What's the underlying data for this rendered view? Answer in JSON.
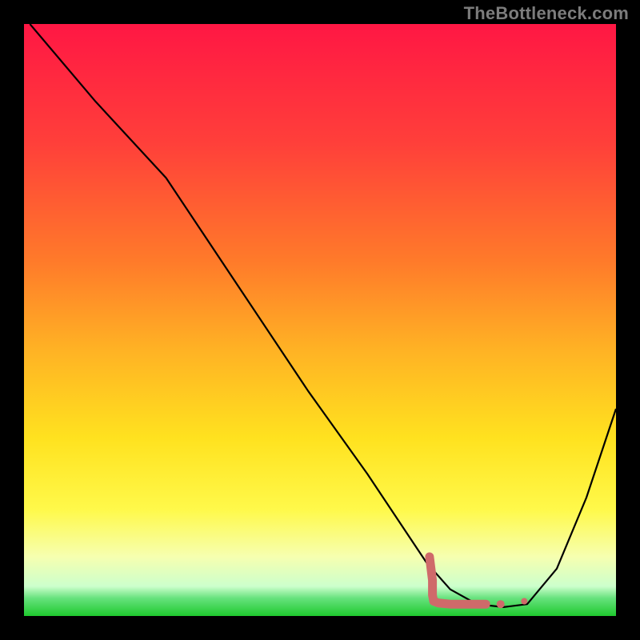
{
  "watermark": "TheBottleneck.com",
  "chart_data": {
    "type": "line",
    "title": "",
    "xlabel": "",
    "ylabel": "",
    "xlim": [
      0,
      100
    ],
    "ylim": [
      0,
      100
    ],
    "background_gradient": {
      "stops": [
        {
          "offset": 0.0,
          "color": "#ff1744"
        },
        {
          "offset": 0.2,
          "color": "#ff3f3a"
        },
        {
          "offset": 0.4,
          "color": "#ff7a2a"
        },
        {
          "offset": 0.55,
          "color": "#ffb224"
        },
        {
          "offset": 0.7,
          "color": "#ffe21f"
        },
        {
          "offset": 0.82,
          "color": "#fff94a"
        },
        {
          "offset": 0.9,
          "color": "#f6ffb0"
        },
        {
          "offset": 0.95,
          "color": "#ccffcc"
        },
        {
          "offset": 0.97,
          "color": "#66e27d"
        },
        {
          "offset": 1.0,
          "color": "#1fc92e"
        }
      ]
    },
    "series": [
      {
        "name": "bottleneck-curve",
        "stroke": "#000000",
        "stroke_width": 2.2,
        "fill": "none",
        "x": [
          1,
          12,
          24,
          36,
          48,
          58,
          64,
          68,
          72,
          76.5,
          81,
          85,
          90,
          95,
          100
        ],
        "y": [
          100,
          87,
          74,
          56,
          38,
          24,
          15,
          9,
          4.5,
          2,
          1.5,
          2,
          8,
          20,
          35
        ]
      },
      {
        "name": "optimal-region-highlight",
        "stroke": "#cf6a6a",
        "stroke_width": 11,
        "linecap": "round",
        "fill": "none",
        "dash": "",
        "x": [
          68.5,
          69,
          69,
          69.2,
          70,
          72,
          75,
          78
        ],
        "y": [
          10,
          6,
          3.5,
          2.5,
          2.2,
          2.0,
          2.0,
          2.0
        ]
      },
      {
        "name": "optimal-dot-1",
        "type": "dot",
        "stroke": "#cf6a6a",
        "r": 5,
        "x": [
          80.5
        ],
        "y": [
          2.0
        ]
      },
      {
        "name": "optimal-dot-2",
        "type": "dot",
        "stroke": "#cf6a6a",
        "r": 4,
        "x": [
          84.5
        ],
        "y": [
          2.5
        ]
      }
    ]
  }
}
